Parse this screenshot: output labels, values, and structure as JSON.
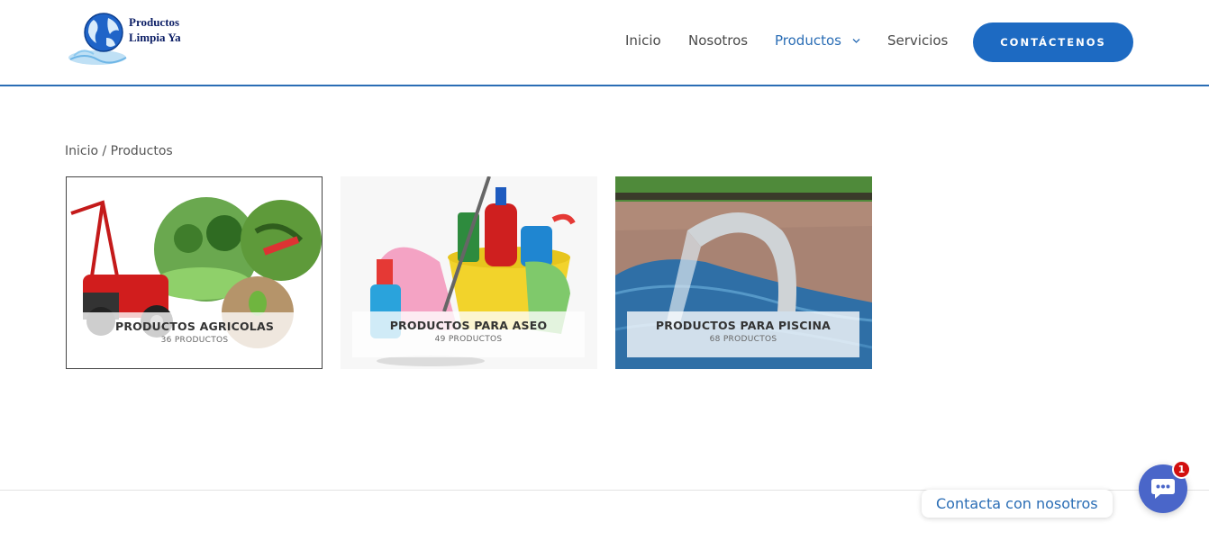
{
  "header": {
    "logo_text_line1": "Productos",
    "logo_text_line2": "Limpia Ya",
    "nav": [
      {
        "label": "Inicio"
      },
      {
        "label": "Nosotros"
      },
      {
        "label": "Productos"
      },
      {
        "label": "Servicios"
      }
    ],
    "cta_label": "CONTÁCTENOS",
    "accent_color": "#1d6ac2"
  },
  "breadcrumb": {
    "home": "Inicio",
    "separator": "/",
    "current": "Productos"
  },
  "categories": [
    {
      "title": "PRODUCTOS AGRICOLAS",
      "count": "36 PRODUCTOS",
      "icon": "agriculture-image"
    },
    {
      "title": "PRODUCTOS PARA ASEO",
      "count": "49 PRODUCTOS",
      "icon": "cleaning-supplies-image"
    },
    {
      "title": "PRODUCTOS PARA PISCINA",
      "count": "68 PRODUCTOS",
      "icon": "pool-image"
    }
  ],
  "chat": {
    "label": "Contacta con nosotros",
    "badge_count": "1",
    "icon": "chat-icon"
  }
}
